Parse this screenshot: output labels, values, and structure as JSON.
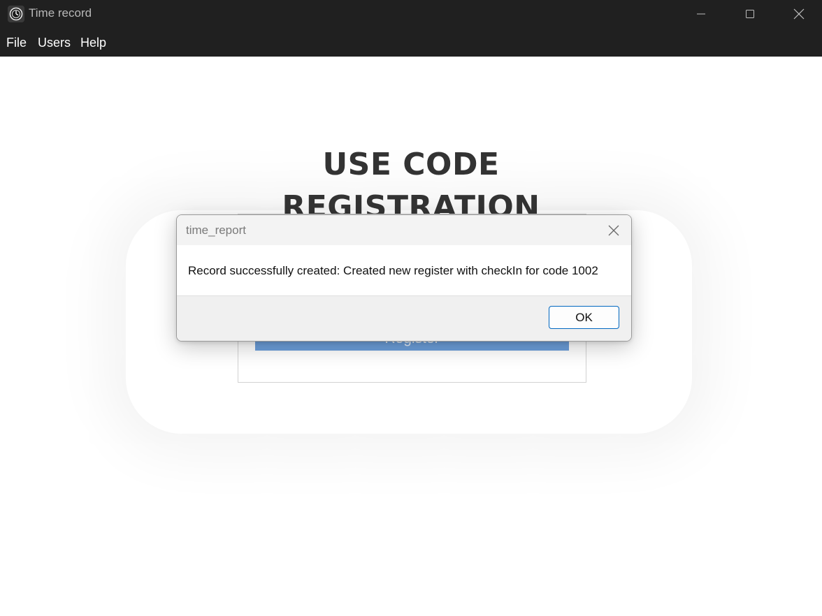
{
  "window": {
    "title": "Time record",
    "icon": "clock-app-icon",
    "controls": [
      "minimize-icon",
      "maximize-icon",
      "close-icon"
    ]
  },
  "menubar": {
    "items": [
      {
        "label": "File"
      },
      {
        "label": "Users"
      },
      {
        "label": "Help"
      }
    ]
  },
  "main": {
    "heading_line1": "USE CODE",
    "heading_line2": "REGISTRATION",
    "register_label": "Register"
  },
  "dialog": {
    "title": "time_report",
    "message": "Record successfully created: Created new register with checkIn for code 1002",
    "ok_label": "OK"
  },
  "colors": {
    "titlebar_bg": "#202020",
    "accent": "#0067c0",
    "register_button": "#6c9fdb",
    "heading": "#333333"
  }
}
